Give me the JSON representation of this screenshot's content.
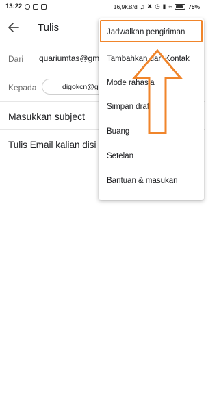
{
  "status_bar": {
    "time": "13:22",
    "speed": "16,9KB/d",
    "battery": "75%"
  },
  "app_bar": {
    "title": "Tulis",
    "back_icon": "arrow-left-icon"
  },
  "compose": {
    "from_label": "Dari",
    "from_value": "quariumtas@gm",
    "to_label": "Kepada",
    "to_chip": "digokcn@gu",
    "subject_placeholder": "Masukkan subject",
    "body_placeholder": "Tulis Email kalian disi"
  },
  "menu": {
    "items": [
      {
        "label": "Jadwalkan pengiriman"
      },
      {
        "label": "Tambahkan dari Kontak"
      },
      {
        "label": "Mode rahasia"
      },
      {
        "label": "Simpan draf"
      },
      {
        "label": "Buang"
      },
      {
        "label": "Setelan"
      },
      {
        "label": "Bantuan & masukan"
      }
    ]
  },
  "annotation": {
    "color": "#f0852b"
  }
}
